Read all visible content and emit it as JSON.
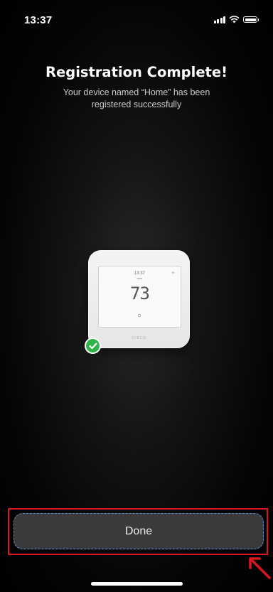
{
  "status_bar": {
    "time": "13:37",
    "icons": [
      "cellular-signal-icon",
      "wifi-icon",
      "battery-icon"
    ]
  },
  "header": {
    "title": "Registration Complete!",
    "subtitle": "Your device named “Home” has been registered successfully"
  },
  "device": {
    "screen_time": "13:37",
    "screen_mode": "Auto",
    "temperature": "73",
    "brand": "CIELO",
    "status_icon": "check-circle-icon",
    "status_color": "#2fb24a"
  },
  "actions": {
    "done_label": "Done"
  },
  "annotation": {
    "highlight_color": "#d9161d",
    "arrow_icon": "red-arrow-icon"
  }
}
